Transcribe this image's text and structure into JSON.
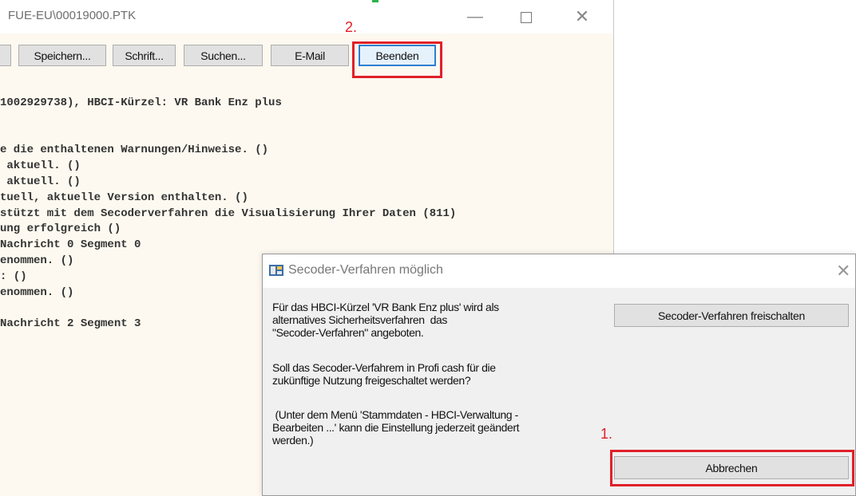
{
  "main_window": {
    "title": "FUE-EU\\00019000.PTK",
    "toolbar": {
      "speichern": "Speichern...",
      "schrift": "Schrift...",
      "suchen": "Suchen...",
      "email": "E-Mail",
      "beenden": "Beenden"
    },
    "log_lines": [
      "1002929738), HBCI-Kürzel: VR Bank Enz plus",
      "",
      "",
      "e die enthaltenen Warnungen/Hinweise. ()",
      " aktuell. ()",
      " aktuell. ()",
      "tuell, aktuelle Version enthalten. ()",
      "stützt mit dem Secoderverfahren die Visualisierung Ihrer Daten (811)",
      "ung erfolgreich ()",
      "Nachricht 0 Segment 0",
      "enommen. ()",
      ": ()",
      "enommen. ()",
      "",
      "Nachricht 2 Segment 3"
    ]
  },
  "annotations": {
    "step1": "1.",
    "step2": "2.",
    "highlight_color": "#e0202a"
  },
  "dialog": {
    "title": "Secoder-Verfahren möglich",
    "paragraph1": "Für das HBCI-Kürzel 'VR Bank Enz plus' wird als\nalternatives Sicherheitsverfahren  das\n\"Secoder-Verfahren\" angeboten.",
    "paragraph2": "Soll das Secoder-Verfahrem in Profi cash für die\nzukünftige Nutzung freigeschaltet werden?",
    "paragraph3": " (Unter dem Menü 'Stammdaten - HBCI-Verwaltung -\nBearbeiten ...' kann die Einstellung jederzeit geändert\nwerden.)",
    "btn_secoder": "Secoder-Verfahren freischalten",
    "btn_abbrechen": "Abbrechen"
  },
  "icons": {
    "close": "close-icon",
    "minimize": "minimize-icon",
    "maximize": "maximize-icon",
    "dialog_app": "app-icon"
  }
}
